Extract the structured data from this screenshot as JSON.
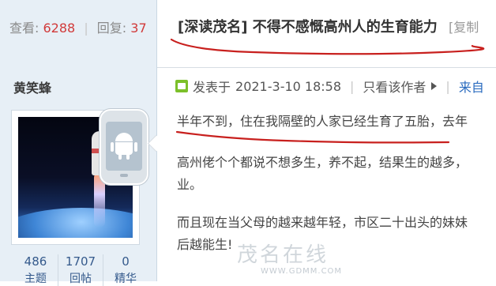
{
  "stats": {
    "views_label": "查看:",
    "views": "6288",
    "replies_label": "回复:",
    "replies": "37"
  },
  "author": {
    "name": "黄笑蜂"
  },
  "profile": [
    {
      "value": "486",
      "label": "主题"
    },
    {
      "value": "1707",
      "label": "回帖"
    },
    {
      "value": "0",
      "label": "精华"
    }
  ],
  "thread": {
    "title": "[深读茂名] 不得不感慨高州人的生育能力",
    "copy_link": "[复制"
  },
  "post": {
    "posted_prefix": "发表于",
    "datetime": "2021-3-10 18:58",
    "only_author": "只看该作者",
    "next": "来自"
  },
  "content": {
    "p1": "半年不到，住在我隔壁的人家已经生育了五胎，去年",
    "p2": "高州佬个个都说不想多生，养不起，结果生的越多，",
    "p2_tail": "业。",
    "p3": "而且现在当父母的越来越年轻，市区二十出头的妹妹",
    "p3_tail": "后越能生!"
  },
  "watermark": {
    "logo": "茂名在线",
    "url": "WWW.GDMM.COM"
  },
  "colors": {
    "accent": "#d13a3a",
    "link": "#2a6bbf",
    "sidebar": "#e7eff6",
    "ink": "#c8201e"
  }
}
